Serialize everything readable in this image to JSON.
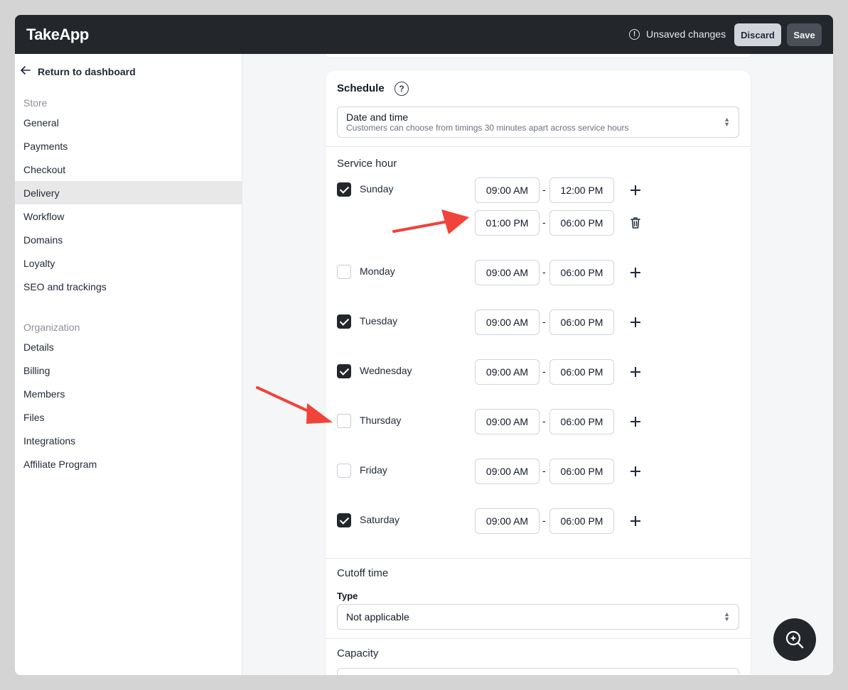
{
  "app": {
    "logo": "TakeApp",
    "unsaved_label": "Unsaved changes",
    "discard_label": "Discard",
    "save_label": "Save"
  },
  "sidebar": {
    "back_label": "Return to dashboard",
    "store_heading": "Store",
    "store_items": [
      {
        "label": "General"
      },
      {
        "label": "Payments"
      },
      {
        "label": "Checkout"
      },
      {
        "label": "Delivery",
        "active": true
      },
      {
        "label": "Workflow"
      },
      {
        "label": "Domains"
      },
      {
        "label": "Loyalty"
      },
      {
        "label": "SEO and trackings"
      }
    ],
    "org_heading": "Organization",
    "org_items": [
      {
        "label": "Details"
      },
      {
        "label": "Billing"
      },
      {
        "label": "Members"
      },
      {
        "label": "Files"
      },
      {
        "label": "Integrations"
      },
      {
        "label": "Affiliate Program"
      }
    ]
  },
  "schedule": {
    "title": "Schedule",
    "mode_select": {
      "label": "Date and time",
      "description": "Customers can choose from timings 30 minutes apart across service hours"
    },
    "service_hour_title": "Service hour",
    "days": [
      {
        "name": "Sunday",
        "checked": true,
        "slots": [
          {
            "start": "09:00 AM",
            "end": "12:00 PM",
            "action": "add"
          },
          {
            "start": "01:00 PM",
            "end": "06:00 PM",
            "action": "delete"
          }
        ]
      },
      {
        "name": "Monday",
        "checked": false,
        "slots": [
          {
            "start": "09:00 AM",
            "end": "06:00 PM",
            "action": "add"
          }
        ]
      },
      {
        "name": "Tuesday",
        "checked": true,
        "slots": [
          {
            "start": "09:00 AM",
            "end": "06:00 PM",
            "action": "add"
          }
        ]
      },
      {
        "name": "Wednesday",
        "checked": true,
        "slots": [
          {
            "start": "09:00 AM",
            "end": "06:00 PM",
            "action": "add"
          }
        ]
      },
      {
        "name": "Thursday",
        "checked": false,
        "slots": [
          {
            "start": "09:00 AM",
            "end": "06:00 PM",
            "action": "add"
          }
        ]
      },
      {
        "name": "Friday",
        "checked": false,
        "slots": [
          {
            "start": "09:00 AM",
            "end": "06:00 PM",
            "action": "add"
          }
        ]
      },
      {
        "name": "Saturday",
        "checked": true,
        "slots": [
          {
            "start": "09:00 AM",
            "end": "06:00 PM",
            "action": "add"
          }
        ]
      }
    ],
    "time_separator": "-",
    "cutoff_title": "Cutoff time",
    "cutoff_type_label": "Type",
    "cutoff_type_value": "Not applicable",
    "capacity_title": "Capacity"
  },
  "colors": {
    "topbar": "#23262b",
    "annotation_arrow": "#f0433a",
    "checked": "#23262b"
  }
}
